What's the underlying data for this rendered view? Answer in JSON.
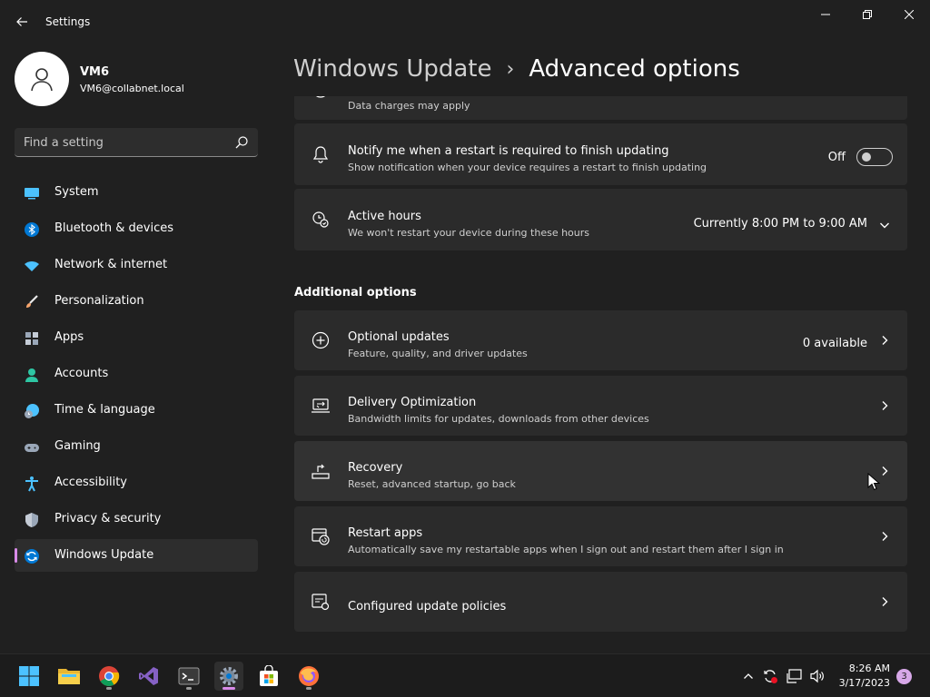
{
  "window": {
    "title": "Settings"
  },
  "profile": {
    "name": "VM6",
    "email": "VM6@collabnet.local"
  },
  "search": {
    "placeholder": "Find a setting"
  },
  "sidebar": {
    "items": [
      {
        "label": "System",
        "icon": "system-icon",
        "color": "#4cc2ff"
      },
      {
        "label": "Bluetooth & devices",
        "icon": "bluetooth-icon",
        "color": "#0078d4"
      },
      {
        "label": "Network & internet",
        "icon": "wifi-icon",
        "color": "#4cc2ff"
      },
      {
        "label": "Personalization",
        "icon": "brush-icon",
        "color": "#f7a56c"
      },
      {
        "label": "Apps",
        "icon": "apps-icon",
        "color": "#9aa7b8"
      },
      {
        "label": "Accounts",
        "icon": "accounts-icon",
        "color": "#2ec6a3"
      },
      {
        "label": "Time & language",
        "icon": "clock-globe-icon",
        "color": "#4cc2ff"
      },
      {
        "label": "Gaming",
        "icon": "gamepad-icon",
        "color": "#9aa7b8"
      },
      {
        "label": "Accessibility",
        "icon": "accessibility-icon",
        "color": "#4cc2ff"
      },
      {
        "label": "Privacy & security",
        "icon": "shield-icon",
        "color": "#9aa7b8"
      },
      {
        "label": "Windows Update",
        "icon": "windows-update-icon",
        "color": "#4cc2ff",
        "selected": true
      }
    ]
  },
  "breadcrumb": {
    "parent": "Windows Update",
    "separator": "›",
    "current": "Advanced options"
  },
  "settings": {
    "metered": {
      "subtitle": "Data charges may apply"
    },
    "notify_restart": {
      "title": "Notify me when a restart is required to finish updating",
      "subtitle": "Show notification when your device requires a restart to finish updating",
      "state": "Off"
    },
    "active_hours": {
      "title": "Active hours",
      "subtitle": "We won't restart your device during these hours",
      "value": "Currently 8:00 PM to 9:00 AM"
    }
  },
  "additional": {
    "heading": "Additional options",
    "items": [
      {
        "title": "Optional updates",
        "subtitle": "Feature, quality, and driver updates",
        "value": "0 available",
        "icon": "plus-circle-icon"
      },
      {
        "title": "Delivery Optimization",
        "subtitle": "Bandwidth limits for updates, downloads from other devices",
        "value": "",
        "icon": "delivery-optimization-icon"
      },
      {
        "title": "Recovery",
        "subtitle": "Reset, advanced startup, go back",
        "value": "",
        "icon": "recovery-icon"
      },
      {
        "title": "Restart apps",
        "subtitle": "Automatically save my restartable apps when I sign out and restart them after I sign in",
        "value": "",
        "icon": "restart-apps-icon"
      },
      {
        "title": "Configured update policies",
        "subtitle": "",
        "value": "",
        "icon": "policies-icon"
      }
    ]
  },
  "taskbar": {
    "apps": [
      "start-icon",
      "file-explorer-icon",
      "chrome-icon",
      "visual-studio-icon",
      "terminal-icon",
      "settings-icon",
      "store-icon",
      "firefox-icon"
    ],
    "active_app": "settings-icon"
  },
  "tray": {
    "time": "8:26 AM",
    "date": "3/17/2023",
    "notification_count": "3"
  },
  "colors": {
    "background": "#202020",
    "card": "#2b2b2b",
    "accent": "#d88ae8",
    "taskbar": "#1c1c1c"
  }
}
